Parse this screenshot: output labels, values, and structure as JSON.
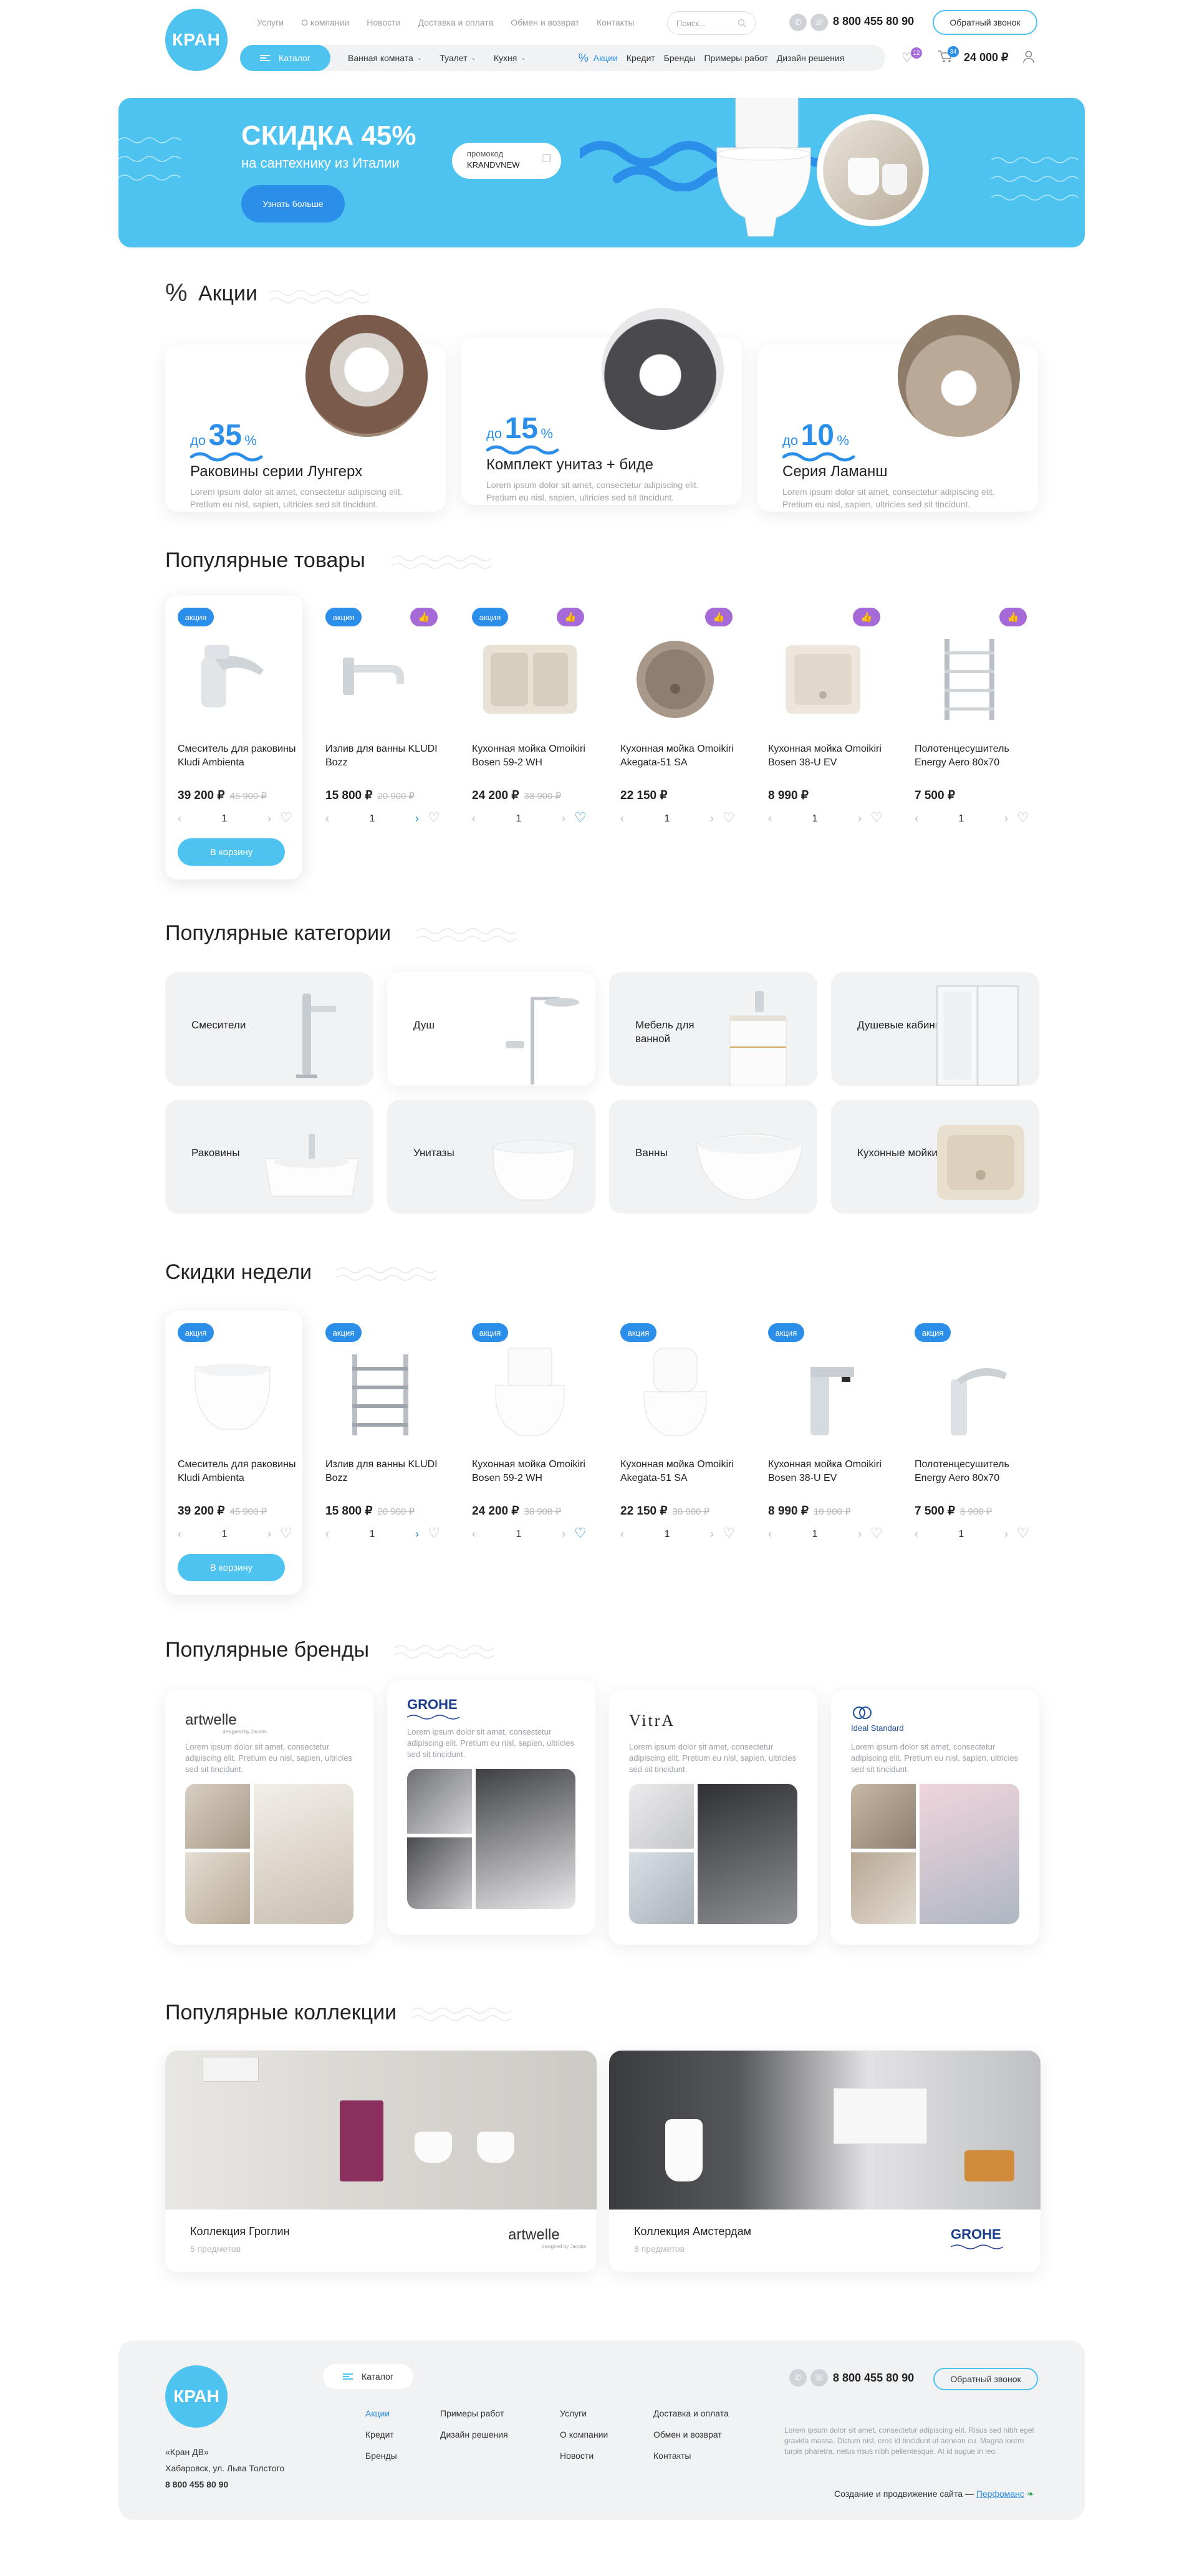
{
  "header": {
    "logo": "КРАН",
    "topnav": [
      "Услуги",
      "О компании",
      "Новости",
      "Доставка и оплата",
      "Обмен и возврат",
      "Контакты"
    ],
    "search_placeholder": "Поиск...",
    "phone": "8 800 455 80 90",
    "callback": "Обратный звонок",
    "catalog": "Каталог",
    "menu": [
      "Ванная комната",
      "Туалет",
      "Кухня"
    ],
    "promo": "Акции",
    "links": [
      "Кредит",
      "Бренды",
      "Примеры работ",
      "Дизайн решения"
    ],
    "favorites_count": "12",
    "cart_count": "34",
    "cart_total": "24 000 ₽"
  },
  "banner": {
    "title": "СКИДКА 45%",
    "subtitle": "на сантехнику из Италии",
    "button": "Узнать больше",
    "promo_label": "промокод",
    "promo_code": "KRANDVNEW"
  },
  "promos": {
    "title": "Акции",
    "items": [
      {
        "prefix": "до",
        "value": "35",
        "unit": "%",
        "title": "Раковины серии Лунгерх",
        "text": "Lorem ipsum dolor sit amet, consectetur adipiscing elit. Pretium eu nisl, sapien, ultricies sed sit tincidunt."
      },
      {
        "prefix": "до",
        "value": "15",
        "unit": "%",
        "title": "Комплект унитаз + биде",
        "text": "Lorem ipsum dolor sit amet, consectetur adipiscing elit. Pretium eu nisl, sapien, ultricies sed sit tincidunt."
      },
      {
        "prefix": "до",
        "value": "10",
        "unit": "%",
        "title": "Серия Ламанш",
        "text": "Lorem ipsum dolor sit amet, consectetur adipiscing elit. Pretium eu nisl, sapien, ultricies sed sit tincidunt."
      }
    ]
  },
  "popular": {
    "title": "Популярные товары",
    "tag": "акция",
    "to_cart": "В корзину",
    "items": [
      {
        "name": "Смеситель для раковины Kludi Ambienta",
        "price": "39 200 ₽",
        "old": "45 900 ₽",
        "qty": "1"
      },
      {
        "name": "Излив для ванны KLUDI Bozz",
        "price": "15 800 ₽",
        "old": "20 900 ₽",
        "qty": "1"
      },
      {
        "name": "Кухонная мойка Omoikiri Bosen 59-2 WH",
        "price": "24 200 ₽",
        "old": "38 900 ₽",
        "qty": "1"
      },
      {
        "name": "Кухонная мойка Omoikiri Akegata-51 SA",
        "price": "22 150 ₽",
        "old": "",
        "qty": "1"
      },
      {
        "name": "Кухонная мойка Omoikiri Bosen 38-U EV",
        "price": "8 990 ₽",
        "old": "",
        "qty": "1"
      },
      {
        "name": "Полотенцесушитель Energy Aero 80x70",
        "price": "7 500 ₽",
        "old": "",
        "qty": "1"
      }
    ]
  },
  "categories": {
    "title": "Популярные категории",
    "items": [
      "Смесители",
      "Душ",
      "Мебель для ванной",
      "Душевые кабины",
      "Раковины",
      "Унитазы",
      "Ванны",
      "Кухонные мойки"
    ]
  },
  "weekly": {
    "title": "Скидки недели",
    "tag": "акция",
    "to_cart": "В корзину",
    "items": [
      {
        "name": "Смеситель для раковины Kludi Ambienta",
        "price": "39 200 ₽",
        "old": "45 900 ₽",
        "qty": "1"
      },
      {
        "name": "Излив для ванны KLUDI Bozz",
        "price": "15 800 ₽",
        "old": "20 900 ₽",
        "qty": "1"
      },
      {
        "name": "Кухонная мойка Omoikiri Bosen 59-2 WH",
        "price": "24 200 ₽",
        "old": "38 900 ₽",
        "qty": "1"
      },
      {
        "name": "Кухонная мойка Omoikiri Akegata-51 SA",
        "price": "22 150 ₽",
        "old": "30 900 ₽",
        "qty": "1"
      },
      {
        "name": "Кухонная мойка Omoikiri Bosen 38-U EV",
        "price": "8 990 ₽",
        "old": "10 900 ₽",
        "qty": "1"
      },
      {
        "name": "Полотенцесушитель Energy Aero 80x70",
        "price": "7 500 ₽",
        "old": "8 900 ₽",
        "qty": "1"
      }
    ]
  },
  "brands": {
    "title": "Популярные бренды",
    "items": [
      {
        "name": "artwelle",
        "sub": "designed by Jacobs",
        "text": "Lorem ipsum dolor sit amet, consectetur adipiscing elit. Pretium eu nisl, sapien, ultricies sed sit tincidunt."
      },
      {
        "name": "GROHE",
        "sub": "",
        "text": "Lorem ipsum dolor sit amet, consectetur adipiscing elit. Pretium eu nisl, sapien, ultricies sed sit tincidunt."
      },
      {
        "name": "VitrA",
        "sub": "",
        "text": "Lorem ipsum dolor sit amet, consectetur adipiscing elit. Pretium eu nisl, sapien, ultricies sed sit tincidunt."
      },
      {
        "name": "Ideal Standard",
        "sub": "",
        "text": "Lorem ipsum dolor sit amet, consectetur adipiscing elit. Pretium eu nisl, sapien, ultricies sed sit tincidunt."
      }
    ]
  },
  "collections": {
    "title": "Популярные коллекции",
    "items": [
      {
        "name": "Коллекция Гроглин",
        "count": "5 предметов",
        "brand": "artwelle",
        "brand_sub": "designed by Jacobs"
      },
      {
        "name": "Коллекция Амстердам",
        "count": "8 предметов",
        "brand": "GROHE"
      }
    ]
  },
  "footer": {
    "logo": "КРАН",
    "company": "«Кран ДВ»",
    "address": "Хабаровск, ул. Льва Толстого",
    "phone_small": "8 800 455 80 90",
    "catalog": "Каталог",
    "col1": [
      "Акции",
      "Кредит",
      "Бренды"
    ],
    "col2": [
      "Примеры работ",
      "Дизайн решения"
    ],
    "col3": [
      "Услуги",
      "О компании",
      "Новости"
    ],
    "col4": [
      "Доставка и оплата",
      "Обмен и возврат",
      "Контакты"
    ],
    "phone": "8 800 455 80 90",
    "callback": "Обратный звонок",
    "desc": "Lorem ipsum dolor sit amet, consectetur adipiscing elit. Risus sed nibh eget gravida massa. Dictum nisl, eros id tincidunt ut aenean eu. Magna lorem turpis pharetra, netus risus nibh pellentesque. At id augue in leo.",
    "dev_text": "Создание и продвижение сайта —",
    "dev_link": "Перфоманс"
  },
  "colors": {
    "accent": "#4ec3ef",
    "blue": "#2b8ee8",
    "purple": "#a56ad8",
    "gray_bg": "#f1f2f4"
  }
}
